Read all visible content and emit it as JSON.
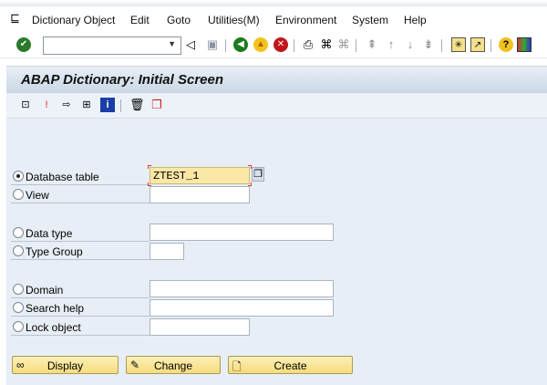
{
  "menu": {
    "items": [
      "Dictionary Object",
      "Edit",
      "Goto",
      "Utilities(M)",
      "Environment",
      "System",
      "Help"
    ]
  },
  "toolbar": {
    "command_field": "",
    "icons": [
      "enter-icon",
      "back-triangle-icon",
      "save-icon",
      "back-icon",
      "exit-icon",
      "cancel-icon",
      "print-icon",
      "find-icon",
      "find-next-icon",
      "first-page-icon",
      "prev-page-icon",
      "next-page-icon",
      "last-page-icon",
      "new-session-icon",
      "shortcut-icon",
      "help-icon",
      "customize-layout-icon"
    ]
  },
  "title": "ABAP Dictionary: Initial Screen",
  "form": {
    "rows": [
      {
        "label": "Database table",
        "value": "ZTEST_1",
        "selected": true
      },
      {
        "label": "View",
        "value": "",
        "selected": false
      },
      {
        "label": "Data type",
        "value": "",
        "selected": false
      },
      {
        "label": "Type Group",
        "value": "",
        "selected": false
      },
      {
        "label": "Domain",
        "value": "",
        "selected": false
      },
      {
        "label": "Search help",
        "value": "",
        "selected": false
      },
      {
        "label": "Lock object",
        "value": "",
        "selected": false
      }
    ]
  },
  "buttons": {
    "display": "Display",
    "change": "Change",
    "create": "Create"
  }
}
